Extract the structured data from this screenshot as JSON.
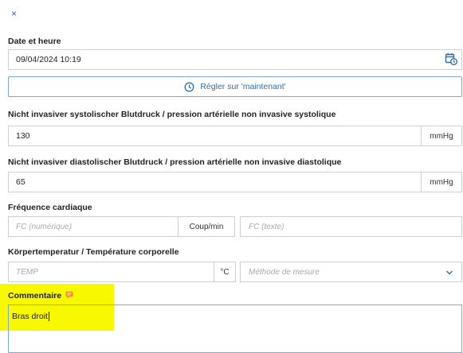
{
  "close_glyph": "×",
  "datetime": {
    "label": "Date et heure",
    "value": "09/04/2024 10:19",
    "icon": "calendar-clock-icon",
    "now_button": "Régler sur 'maintenant'",
    "now_icon": "clock-icon"
  },
  "systolic": {
    "label": "Nicht invasiver systolischer Blutdruck / pression artérielle non invasive systolique",
    "value": "130",
    "unit": "mmHg"
  },
  "diastolic": {
    "label": "Nicht invasiver diastolischer Blutdruck / pression artérielle non invasive diastolique",
    "value": "65",
    "unit": "mmHg"
  },
  "heart_rate": {
    "label": "Fréquence cardiaque",
    "numeric_placeholder": "FC (numérique)",
    "unit": "Coup/min",
    "text_placeholder": "FC (texte)"
  },
  "temperature": {
    "label": "Körpertemperatur / Température corporelle",
    "placeholder": "TEMP",
    "unit": "°C",
    "method_placeholder": "Méthode de mesure",
    "method_icon": "chevron-down-icon"
  },
  "comment": {
    "label": "Commentaire",
    "icon": "comment-icon",
    "value": "Bras droit"
  },
  "colors": {
    "accent": "#2b6cb0",
    "highlight": "#f8f800",
    "comment_icon": "#f28c28"
  }
}
